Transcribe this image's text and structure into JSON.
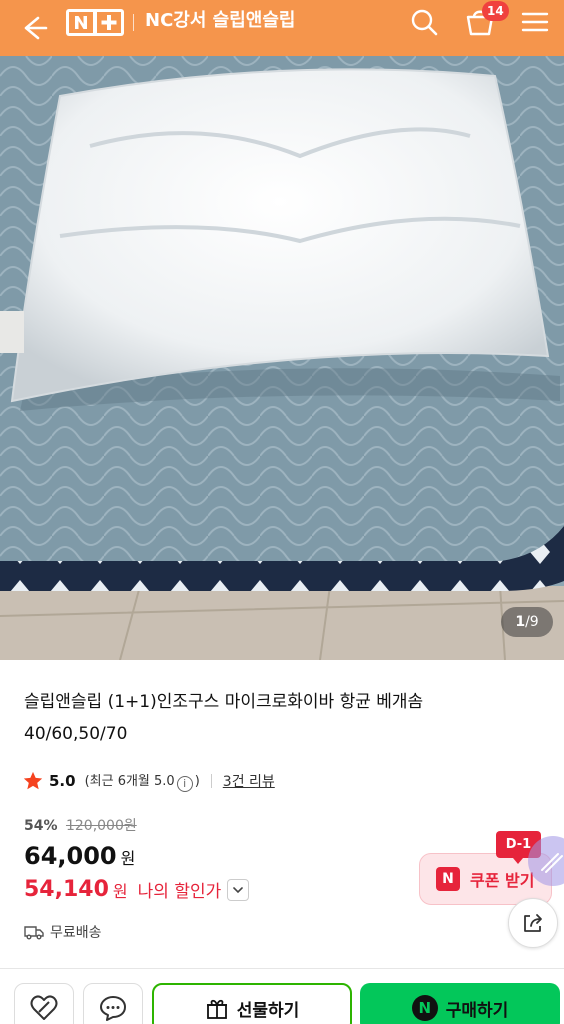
{
  "header": {
    "logo": "N+",
    "title": "NC강서 슬립앤슬립",
    "cart_count": "14",
    "icons": [
      "back-arrow-icon",
      "search-icon",
      "cart-icon",
      "menu-icon"
    ]
  },
  "gallery": {
    "current": "1",
    "total": "/9"
  },
  "product": {
    "title": "슬립앤슬립 (1+1)인조구스 마이크로화이바 항균 베개솜 40/60,50/70",
    "rating": "5.0",
    "rating_note_prefix": "(최근 6개월 5.0",
    "rating_note_info": "i",
    "rating_note_suffix": ")",
    "review_link": "3건 리뷰",
    "discount_rate": "54%",
    "original_price": "120,000원",
    "price": "64,000",
    "price_unit": "원",
    "my_price": "54,140",
    "my_price_unit": "원",
    "my_price_label": "나의 할인가",
    "shipping": "무료배송"
  },
  "coupon": {
    "badge": "D-1",
    "icon_letter": "N",
    "label": "쿠폰 받기"
  },
  "bottom_bar": {
    "gift_label": "선물하기",
    "buy_icon": "N",
    "buy_label": "구매하기"
  },
  "colors": {
    "header_bg": "#f5954c",
    "cart_badge": "#f0413e",
    "sale_red": "#e6243b",
    "buy_green": "#03c75a",
    "gift_border": "#2db400",
    "coupon_bg": "#fde5e8"
  }
}
